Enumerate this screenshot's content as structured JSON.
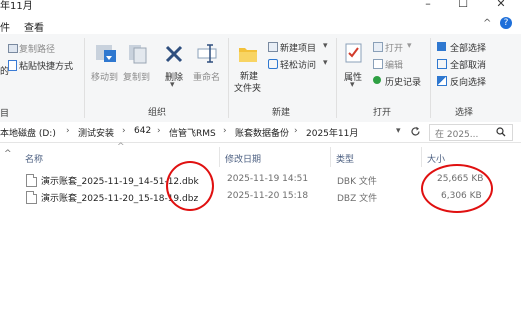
{
  "window": {
    "title": "年11月",
    "minimize": "–",
    "maximize": "☐",
    "close": "✕"
  },
  "tabs": {
    "items": [
      "件",
      "查看"
    ],
    "expand": "^",
    "help": "?"
  },
  "ribbon": {
    "clipboard": {
      "copy_path": "复制路径",
      "paste_shortcut": "粘贴快捷方式"
    },
    "organize": {
      "move_to": "移动到",
      "copy_to": "复制到",
      "delete": "删除",
      "rename": "重命名",
      "group": "组织"
    },
    "new": {
      "new_folder_line1": "新建",
      "new_folder_line2": "文件夹",
      "new_item": "新建项目",
      "easy_access": "轻松访问",
      "group": "新建"
    },
    "open": {
      "properties": "属性",
      "open": "打开",
      "edit": "编辑",
      "history": "历史记录",
      "group": "打开"
    },
    "select": {
      "select_all": "全部选择",
      "select_none": "全部取消",
      "invert": "反向选择",
      "group": "选择"
    },
    "left_fragments": [
      "的",
      "目"
    ]
  },
  "address": {
    "crumbs": [
      "本地磁盘 (D:)",
      "测试安装",
      "642",
      "信管飞RMS",
      "账套数据备份",
      "2025年11月"
    ],
    "search_placeholder": "在 2025..."
  },
  "columns": {
    "name": "名称",
    "date": "修改日期",
    "type": "类型",
    "size": "大小"
  },
  "files": [
    {
      "name": "演示账套_2025-11-19_14-51-12.dbk",
      "date": "2025-11-19 14:51",
      "type": "DBK 文件",
      "size": "25,665 KB"
    },
    {
      "name": "演示账套_2025-11-20_15-18-19.dbz",
      "date": "2025-11-20 15:18",
      "type": "DBZ 文件",
      "size": "6,306 KB"
    }
  ],
  "colors": {
    "accent": "#1e6fd9",
    "annotation": "#e01010"
  }
}
